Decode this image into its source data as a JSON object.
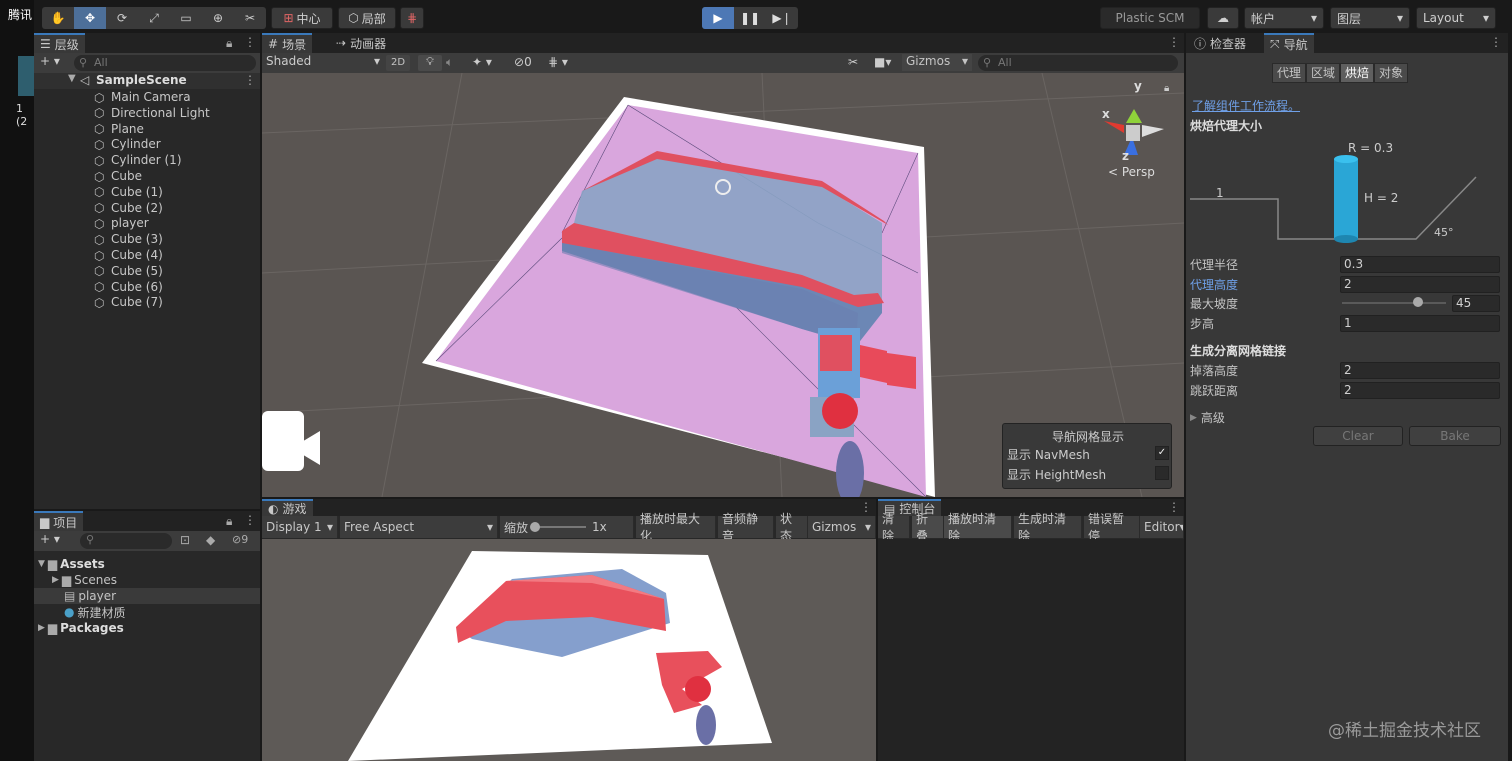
{
  "left_edge": {
    "text1": "腾讯",
    "text2": "1 (2"
  },
  "toolbar": {
    "center_label": "中心",
    "local_label": "局部",
    "plastic_label": "Plastic SCM",
    "account_label": "帐户",
    "layers_label": "图层",
    "layout_label": "Layout"
  },
  "hierarchy": {
    "tab_label": "层级",
    "search_placeholder": "All",
    "scene_name": "SampleScene",
    "items": [
      "Main Camera",
      "Directional Light",
      "Plane",
      "Cylinder",
      "Cylinder (1)",
      "Cube",
      "Cube (1)",
      "Cube (2)",
      "player",
      "Cube (3)",
      "Cube (4)",
      "Cube (5)",
      "Cube (6)",
      "Cube (7)"
    ]
  },
  "scene": {
    "tab_scene": "场景",
    "tab_animator": "动画器",
    "shading_mode": "Shaded",
    "btn_2d": "2D",
    "hidden_count": "0",
    "gizmos_label": "Gizmos",
    "search_placeholder": "All",
    "gizmo_y": "y",
    "gizmo_x": "x",
    "gizmo_z": "z",
    "persp_label": "< Persp",
    "nav_overlay": {
      "title": "导航网格显示",
      "show_navmesh": "显示 NavMesh",
      "show_heightmesh": "显示 HeightMesh"
    }
  },
  "game": {
    "tab_label": "游戏",
    "display": "Display 1",
    "aspect": "Free Aspect",
    "scale_label": "缩放",
    "scale_value": "1x",
    "maximize": "播放时最大化",
    "mute": "音频静音",
    "stats": "状态",
    "gizmos": "Gizmos"
  },
  "console": {
    "tab_label": "控制台",
    "clear": "清除",
    "collapse": "折叠",
    "clear_on_play": "播放时清除",
    "clear_on_build": "生成时清除",
    "error_pause": "错误暂停",
    "editor": "Editor"
  },
  "project": {
    "tab_label": "项目",
    "hidden_count": "9",
    "tree": [
      "Assets",
      "Scenes",
      "player",
      "新建材质",
      "Packages"
    ]
  },
  "inspector": {
    "tab_inspector": "检查器",
    "tab_navigation": "导航",
    "subtabs": [
      "代理",
      "区域",
      "烘焙",
      "对象"
    ],
    "link": "了解组件工作流程。",
    "section_title": "烘焙代理大小",
    "diagram": {
      "r_label": "R = 0.3",
      "h_label": "H = 2",
      "step_label": "1",
      "angle_label": "45°"
    },
    "fields": [
      {
        "label": "代理半径",
        "value": "0.3"
      },
      {
        "label": "代理高度",
        "value": "2"
      },
      {
        "label": "最大坡度",
        "value": "45"
      },
      {
        "label": "步高",
        "value": "1"
      }
    ],
    "offmesh_title": "生成分离网格链接",
    "offmesh_fields": [
      {
        "label": "掉落高度",
        "value": "2"
      },
      {
        "label": "跳跃距离",
        "value": "2"
      }
    ],
    "advanced_label": "高级",
    "clear_btn": "Clear",
    "bake_btn": "Bake"
  },
  "watermark": "@稀土掘金技术社区"
}
